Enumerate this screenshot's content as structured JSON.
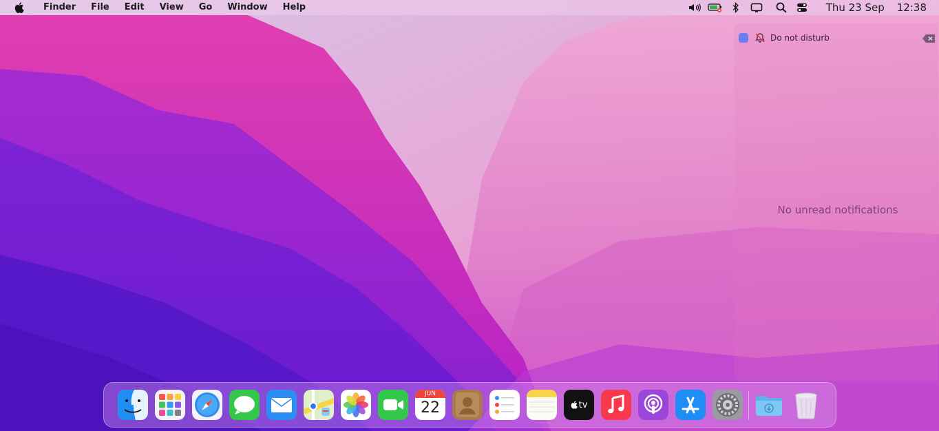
{
  "menubar": {
    "apple_icon": "apple-logo-icon",
    "items": [
      "Finder",
      "File",
      "Edit",
      "View",
      "Go",
      "Window",
      "Help"
    ],
    "status_icons": [
      "volume-icon",
      "battery-icon",
      "bluetooth-icon",
      "display-icon",
      "search-icon",
      "control-center-icon"
    ],
    "date": "Thu 23 Sep",
    "time": "12:38"
  },
  "notifications": {
    "dnd_label": "Do not disturb",
    "empty_message": "No unread notifications"
  },
  "dock": {
    "apps": [
      {
        "name": "finder-icon"
      },
      {
        "name": "launchpad-icon"
      },
      {
        "name": "safari-icon"
      },
      {
        "name": "messages-icon"
      },
      {
        "name": "mail-icon"
      },
      {
        "name": "maps-icon"
      },
      {
        "name": "photos-icon"
      },
      {
        "name": "facetime-icon"
      },
      {
        "name": "calendar-icon",
        "month": "JUN",
        "day": "22"
      },
      {
        "name": "contacts-icon"
      },
      {
        "name": "reminders-icon"
      },
      {
        "name": "notes-icon"
      },
      {
        "name": "apple-tv-icon",
        "label": "tv"
      },
      {
        "name": "music-icon"
      },
      {
        "name": "podcasts-icon"
      },
      {
        "name": "app-store-icon"
      },
      {
        "name": "system-preferences-icon"
      },
      {
        "name": "downloads-folder-icon"
      },
      {
        "name": "trash-icon"
      }
    ]
  }
}
